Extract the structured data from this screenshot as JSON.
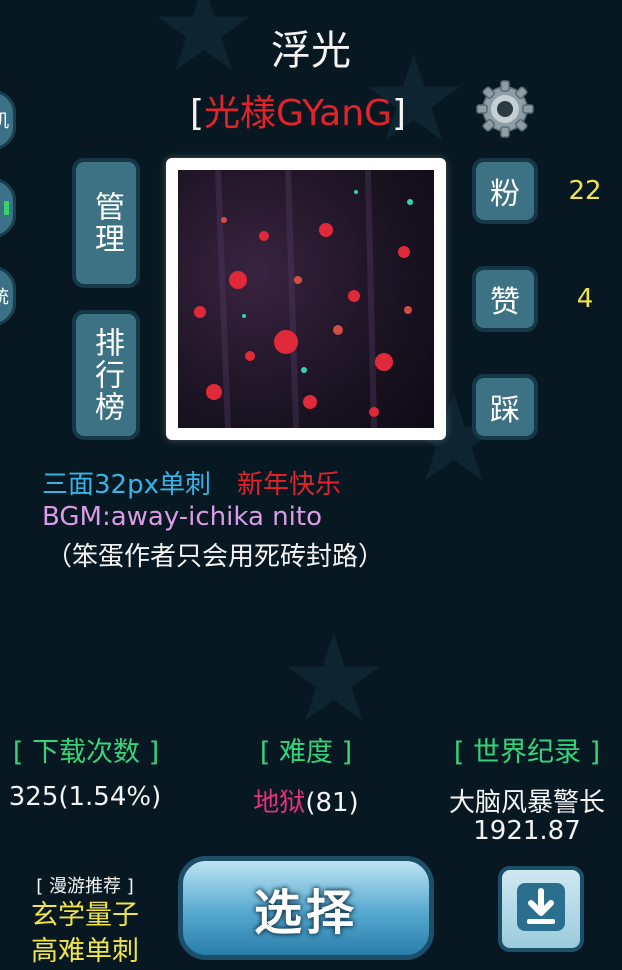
{
  "level": {
    "title": "浮光",
    "author_open": "[",
    "author_name": "光様GYanG",
    "author_close": "]"
  },
  "side_buttons": [
    {
      "label": "机",
      "icon": ""
    },
    {
      "label": "",
      "icon": "green-bar-icon"
    },
    {
      "label": "统",
      "icon": ""
    }
  ],
  "left_buttons": {
    "manage": "管理",
    "ranking": "排行榜"
  },
  "right_buttons": {
    "fans_label": "粉",
    "fans_count": "22",
    "like_label": "赞",
    "like_count": "4",
    "dislike_label": "踩"
  },
  "description": {
    "line1_a": "三面32px单刺",
    "line1_b": "新年快乐",
    "line2": "BGM:away-ichika nito",
    "line3": "（笨蛋作者只会用死砖封路）"
  },
  "stats": {
    "downloads_header": "[ 下载次数 ]",
    "downloads_value": "325(1.54%)",
    "difficulty_header": "[ 难度 ]",
    "difficulty_name": "地狱",
    "difficulty_value": "(81)",
    "record_header": "[ 世界纪录 ]",
    "record_holder": "大脑风暴警长",
    "record_time": "1921.87"
  },
  "roam": {
    "header": "[ 漫游推荐 ]",
    "line1": "玄学量子",
    "line2": "高难单刺"
  },
  "actions": {
    "select_label": "选择",
    "download_icon": "download-icon"
  },
  "colors": {
    "background": "#071822",
    "button": "#3d7284",
    "author_red": "#e2232a",
    "count_yellow": "#f1e34a",
    "stat_green": "#34d47a",
    "difficulty_pink": "#e3337a"
  }
}
